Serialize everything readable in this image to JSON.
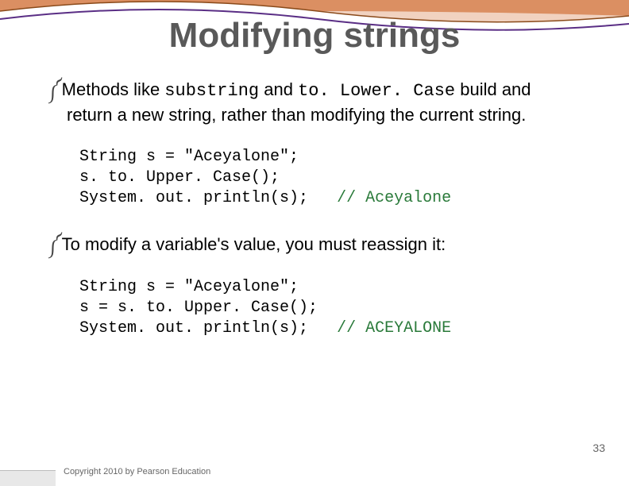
{
  "title": "Modifying strings",
  "bullet_symbol": "༼",
  "para1": {
    "pre": "Methods like ",
    "code1": "substring",
    "mid1": " and ",
    "code2": "to. Lower. Case",
    "post": " build and return a new string, rather than modifying the current string."
  },
  "code1": {
    "l1": "String s = \"Aceyalone\";",
    "l2": "s. to. Upper. Case();",
    "l3a": "System. out. println(s);   ",
    "l3b": "// Aceyalone"
  },
  "para2": "To modify a variable's value, you must reassign it:",
  "code2": {
    "l1": "String s = \"Aceyalone\";",
    "l2": "s = s. to. Upper. Case();",
    "l3a": "System. out. println(s);   ",
    "l3b": "// ACEYALONE"
  },
  "footer": "Copyright 2010 by Pearson Education",
  "page": "33"
}
